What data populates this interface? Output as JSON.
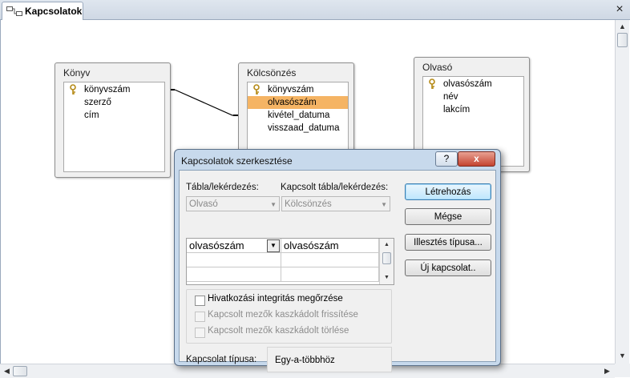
{
  "window": {
    "tab_label": "Kapcsolatok",
    "close_glyph": "×"
  },
  "tables": {
    "konyv": {
      "title": "Könyv",
      "fields": [
        {
          "name": "könyvszám",
          "key": true
        },
        {
          "name": "szerző",
          "key": false
        },
        {
          "name": "cím",
          "key": false
        }
      ]
    },
    "kolcsonzes": {
      "title": "Kölcsönzés",
      "fields": [
        {
          "name": "könyvszám",
          "key": true
        },
        {
          "name": "olvasószám",
          "key": false,
          "selected": true
        },
        {
          "name": "kivétel_datuma",
          "key": false
        },
        {
          "name": "visszaad_datuma",
          "key": false
        }
      ]
    },
    "olvaso": {
      "title": "Olvasó",
      "fields": [
        {
          "name": "olvasószám",
          "key": true
        },
        {
          "name": "név",
          "key": false
        },
        {
          "name": "lakcím",
          "key": false
        }
      ]
    }
  },
  "dialog": {
    "title": "Kapcsolatok szerkesztése",
    "help_glyph": "?",
    "close_glyph": "x",
    "table_label": "Tábla/lekérdezés:",
    "related_table_label": "Kapcsolt tábla/lekérdezés:",
    "table_value": "Olvasó",
    "related_table_value": "Kölcsönzés",
    "grid_rows": [
      {
        "left": "olvasószám",
        "right": "olvasószám"
      },
      {
        "left": "",
        "right": ""
      },
      {
        "left": "",
        "right": ""
      }
    ],
    "buttons": {
      "create": "Létrehozás",
      "cancel": "Mégse",
      "join_type": "Illesztés típusa...",
      "new_relation": "Új kapcsolat.."
    },
    "checkboxes": {
      "integrity": "Hivatkozási integritás megőrzése",
      "cascade_update": "Kapcsolt mezők kaszkádolt frissítése",
      "cascade_delete": "Kapcsolt mezők kaszkádolt törlése"
    },
    "relation_type_label": "Kapcsolat típusa:",
    "relation_type_value": "Egy-a-többhöz"
  },
  "colors": {
    "selected_field": "#f5b464",
    "dialog_frame": "#c7d9ec"
  }
}
